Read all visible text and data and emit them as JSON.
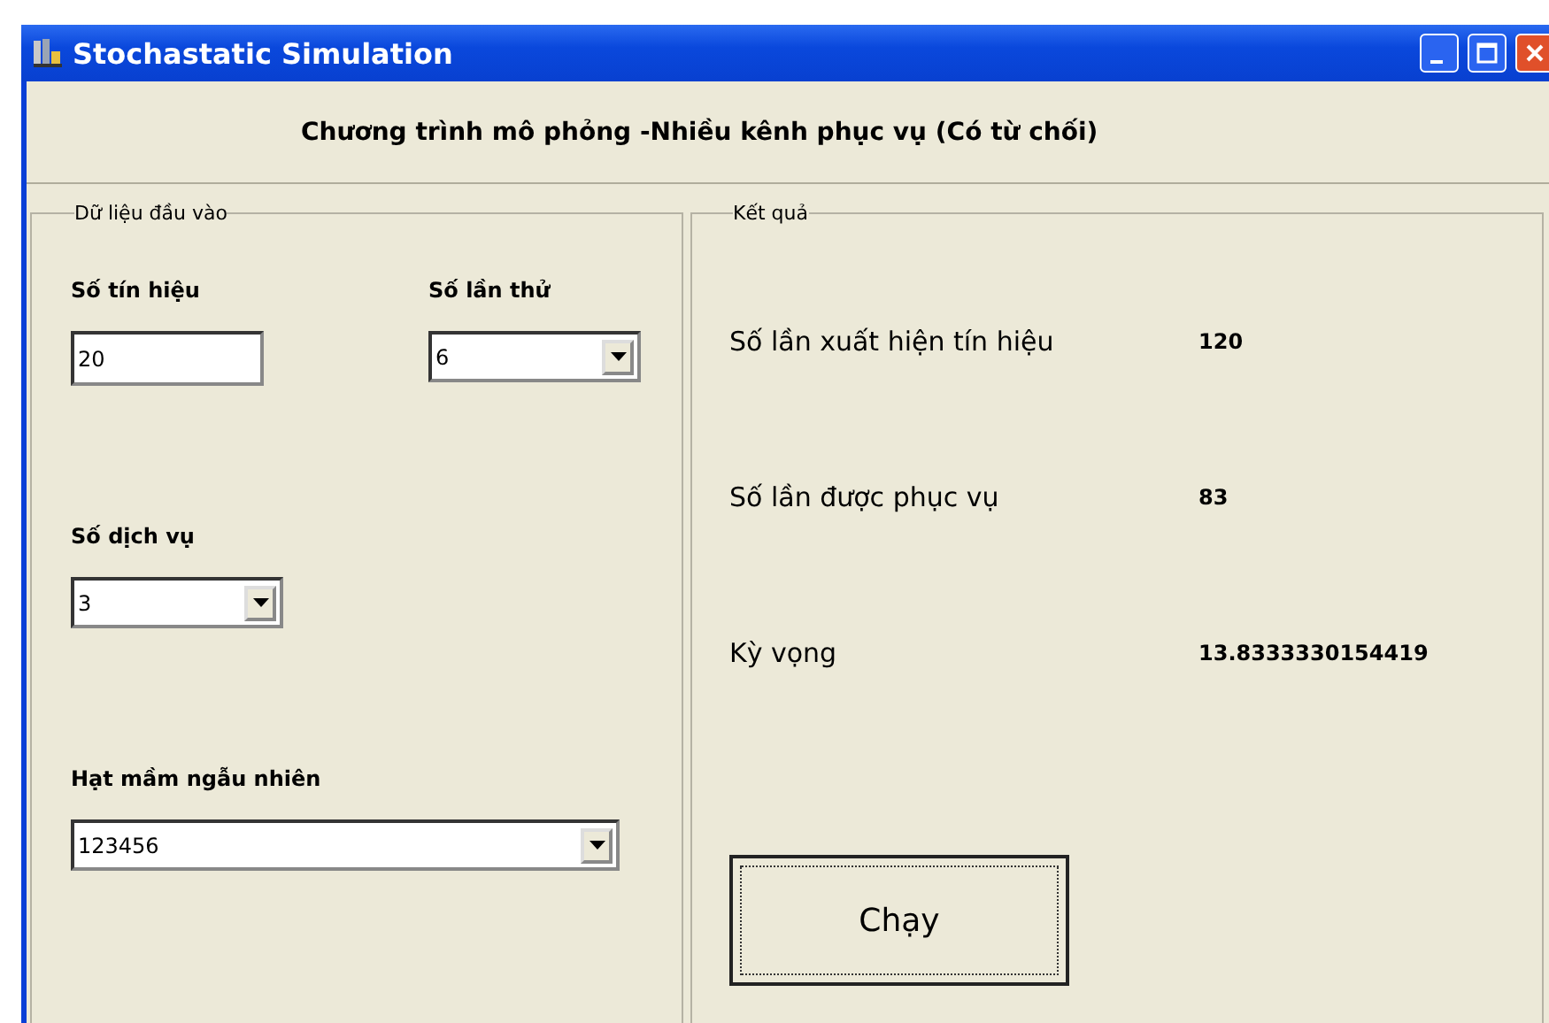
{
  "window": {
    "title": "Stochastatic Simulation"
  },
  "header": "Chương trình mô phỏng -Nhiều kênh phục vụ (Có từ chối)",
  "input_group": {
    "legend": "Dữ liệu đầu vào",
    "fields": [
      {
        "kind": "text",
        "label": "Số tín hiệu",
        "value": "20"
      },
      {
        "kind": "combo",
        "label": "Số lần thử",
        "value": "6"
      },
      {
        "kind": "combo",
        "label": "Số dịch vụ",
        "value": "3"
      },
      {
        "kind": "combo",
        "label": "Hạt mầm ngẫu nhiên",
        "value": "123456"
      }
    ]
  },
  "result_group": {
    "legend": "Kết quả",
    "rows": [
      {
        "label": "Số lần xuất hiện tín hiệu",
        "value": "120"
      },
      {
        "label": "Số lần được phục vụ",
        "value": "83"
      },
      {
        "label": "Kỳ vọng",
        "value": "13.8333330154419"
      }
    ]
  },
  "run_button": {
    "label": "Chạy",
    "focused": true
  }
}
